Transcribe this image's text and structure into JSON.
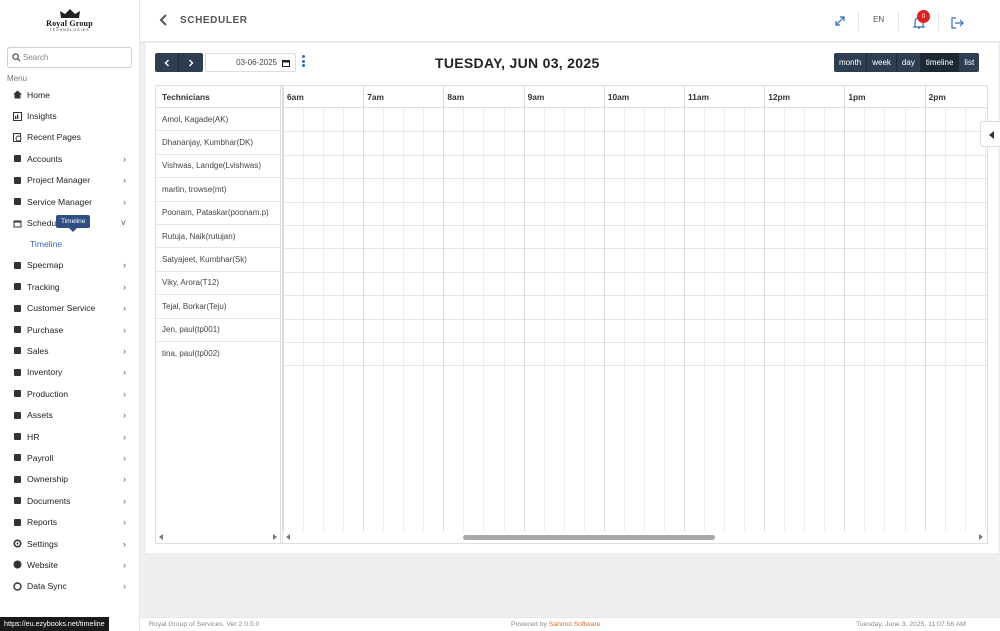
{
  "logo": {
    "name": "Royal Group",
    "sub": "TECHNOLOGIES"
  },
  "search": {
    "placeholder": "Search"
  },
  "menu_label": "Menu",
  "sidebar": {
    "items": [
      {
        "label": "Home",
        "icon": "home-icon",
        "chevron": false
      },
      {
        "label": "Insights",
        "icon": "insights-icon",
        "chevron": false
      },
      {
        "label": "Recent Pages",
        "icon": "recent-pages-icon",
        "chevron": false
      },
      {
        "label": "Accounts",
        "icon": "accounts-icon",
        "chevron": true
      },
      {
        "label": "Project Manager",
        "icon": "project-manager-icon",
        "chevron": true
      },
      {
        "label": "Service Manager",
        "icon": "service-manager-icon",
        "chevron": true
      },
      {
        "label": "Scheduler",
        "icon": "scheduler-icon",
        "chevron": true,
        "expanded": true
      }
    ],
    "subitem": "Timeline",
    "items2": [
      {
        "label": "Specmap",
        "icon": "specmap-icon"
      },
      {
        "label": "Tracking",
        "icon": "tracking-icon"
      },
      {
        "label": "Customer Service",
        "icon": "customer-service-icon"
      },
      {
        "label": "Purchase",
        "icon": "purchase-icon"
      },
      {
        "label": "Sales",
        "icon": "sales-icon"
      },
      {
        "label": "Inventory",
        "icon": "inventory-icon"
      },
      {
        "label": "Production",
        "icon": "production-icon"
      },
      {
        "label": "Assets",
        "icon": "assets-icon"
      },
      {
        "label": "HR",
        "icon": "hr-icon"
      },
      {
        "label": "Payroll",
        "icon": "payroll-icon"
      },
      {
        "label": "Ownership",
        "icon": "ownership-icon"
      },
      {
        "label": "Documents",
        "icon": "documents-icon"
      },
      {
        "label": "Reports",
        "icon": "reports-icon"
      },
      {
        "label": "Settings",
        "icon": "settings-icon"
      },
      {
        "label": "Website",
        "icon": "website-icon"
      },
      {
        "label": "Data Sync",
        "icon": "data-sync-icon"
      }
    ],
    "tooltip": "Timeline"
  },
  "header": {
    "title": "SCHEDULER",
    "language": "EN",
    "notification_count": "0"
  },
  "toolbar": {
    "date_value": "03-06-2025",
    "title": "TUESDAY, JUN 03, 2025",
    "views": [
      "month",
      "week",
      "day",
      "timeline",
      "list"
    ],
    "active_view": "timeline"
  },
  "timeline": {
    "resource_header": "Technicians",
    "technicians": [
      "Amol, Kagade(AK)",
      "Dhananjay, Kumbhar(DK)",
      "Vishwas, Landge(Lvishwas)",
      "martin, trowse(mt)",
      "Poonam, Pataskar(poonam.p)",
      "Rutuja, Naik(rutujan)",
      "Satyajeet, Kumbhar(Sk)",
      "Viky, Arora(T12)",
      "Tejal, Borkar(Teju)",
      "Jen, paul(tp001)",
      "tina, paul(tp002)"
    ],
    "hours": [
      "6am",
      "7am",
      "8am",
      "9am",
      "10am",
      "11am",
      "12pm",
      "1pm",
      "2pm"
    ]
  },
  "footer": {
    "left": "Royal Group of Services. Ver 2.0.0.0",
    "powered_prefix": "Powered by ",
    "powered_brand": "Sanmol Software",
    "datetime": "Tuesday, June 3, 2025, 11:07:56 AM"
  },
  "status_url": "https://eu.ezybooks.net/timeline"
}
